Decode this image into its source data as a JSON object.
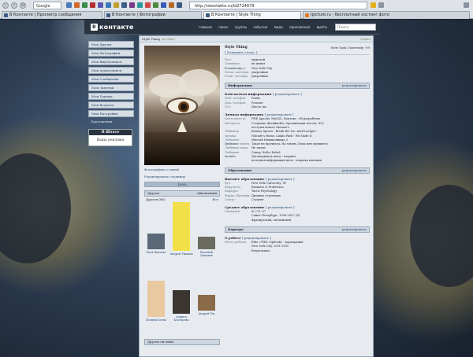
{
  "browser": {
    "google_search": "Google",
    "address": "http://vkontakte.ru/id2724679",
    "tabs": [
      {
        "label": "В Контакте | Просмотр сообщения"
      },
      {
        "label": "В Контакте | Фотографии"
      },
      {
        "label": "В Контакте | Style Thing"
      },
      {
        "label": "Ipicture.ru - бесплатный хостинг фото"
      }
    ]
  },
  "site": {
    "logo": "контакте",
    "logo_badge": "В",
    "topnav": [
      "главная",
      "поиск",
      "группы",
      "события",
      "люди",
      "приложения",
      "выйти"
    ],
    "search_placeholder": "Поиск"
  },
  "sidebar": {
    "items": [
      {
        "label": "Мои Друзья"
      },
      {
        "label": "Мои Фотографии"
      },
      {
        "label": "Мои Видеозаписи"
      },
      {
        "label": "Мои Аудиозаписи"
      },
      {
        "label": "Мои Сообщения"
      },
      {
        "label": "Мои Заметки"
      },
      {
        "label": "Мои Группы"
      },
      {
        "label": "Мои Встречи"
      },
      {
        "label": "Мои Настройки"
      }
    ],
    "apps": "Приложения",
    "shtab_title": "В Штате",
    "shtab_sub": "Ваша реклама"
  },
  "profile": {
    "title_bar": "Style Thing",
    "title_status": "(не был)",
    "title_right": "Online",
    "name": "Style Thing",
    "university": "New York University '09",
    "change_status": "[ Изменить статус ]",
    "photos_link": "Фотографии со мной",
    "edit_link": "Редактировать страницу",
    "progress_text": "100%",
    "progress_value": 100,
    "friends_head": "Друзья",
    "friends_head_right": "обновления",
    "friends_count": "Друзья (86)",
    "friends_all": "Все",
    "friends": [
      {
        "name": "Катя Хвалова"
      },
      {
        "name": "Андрей Ушаков"
      },
      {
        "name": "Василий Демаков"
      },
      {
        "name": "Полина Котко"
      },
      {
        "name": "Алфиса Кохтарева"
      },
      {
        "name": "Андрей Уш"
      }
    ],
    "friends_online": "Друзья он-лайн",
    "basic": [
      {
        "k": "Пол:",
        "v": "мужской"
      },
      {
        "k": "Семейное положение:",
        "v": "не женат"
      },
      {
        "k": "Родной город:",
        "v": "New York City"
      },
      {
        "k": "Полит. взгляды:",
        "v": "умеренные"
      },
      {
        "k": "Религ. взгляды:",
        "v": "умеренные"
      }
    ],
    "info_head": "Информация",
    "edit": "редактировать",
    "contacts_head": "Контактная информация",
    "contacts_edit": "[ редактировать ]",
    "contacts": [
      {
        "k": "Моб. телефон:",
        "v": "Prada"
      },
      {
        "k": "Дом. телефон:",
        "v": "Premier"
      },
      {
        "k": "ICQ:",
        "v": "Шесть Ins"
      }
    ],
    "personal_head": "Личная информация",
    "personal_edit": "[ редактировать ]",
    "personal": [
      {
        "k": "Деятельность:",
        "v": "PHP, Apache, MySQL, Контакт, <В разработке"
      },
      {
        "k": "Интересы:",
        "v": "Создание ДизайнеРы, Организация постов, ICQ"
      },
      {
        "k": "",
        "v": "поступы нового типового"
      },
      {
        "k": "Любимая музыка:",
        "v": "Britney Spears - Break the Ice, Avril Lavigne -"
      },
      {
        "k": "",
        "v": "Nobody's Home, Linkin Park - We Made It"
      },
      {
        "k": "Любимые фильмы:",
        "v": "Миссия Невыполнима 3"
      },
      {
        "k": "Любимые книги:",
        "v": "Такое не прочитал, На землю, Блок мне прежнего"
      },
      {
        "k": "Любимые игры:",
        "v": "Не читаю"
      },
      {
        "k": "Любимые цитаты:",
        "v": "Сапер, Хабл, Befrel"
      },
      {
        "k": "О себе:",
        "v": "Договорились шаги - взорвал"
      },
      {
        "k": "",
        "v": "полезная информация цель - покупка питания"
      }
    ],
    "education_head": "Образование",
    "higher_head": "Высшее образование",
    "higher_edit": "[ редактировать ]",
    "higher": [
      {
        "k": "Вуз:",
        "v": "New York University '09"
      },
      {
        "k": "Факультет:",
        "v": "Business & Profession"
      },
      {
        "k": "Кафедра:",
        "v": "Tactic Psychology"
      },
      {
        "k": "Форма обучения:",
        "v": "Дневное отделение"
      },
      {
        "k": "Статус:",
        "v": "Студент"
      }
    ],
    "middle_head": "Среднее образование",
    "middle_edit": "[ редактировать ]",
    "middle": [
      {
        "k": "Гимназия:",
        "v": "№ 271 '07"
      },
      {
        "k": "",
        "v": "Санкт-Петербург, 1990-2007 (II)"
      },
      {
        "k": "",
        "v": "Французский, английский"
      }
    ],
    "career_head": "Карьера",
    "work_head": "О работе",
    "work_edit": "[ редактировать ]",
    "work": [
      {
        "k": "Место работы:",
        "v": "Elite «THE «Splendi» - корпорация"
      },
      {
        "k": "",
        "v": "New York City, 2001-2010"
      },
      {
        "k": "",
        "v": "Владельцам"
      }
    ]
  }
}
